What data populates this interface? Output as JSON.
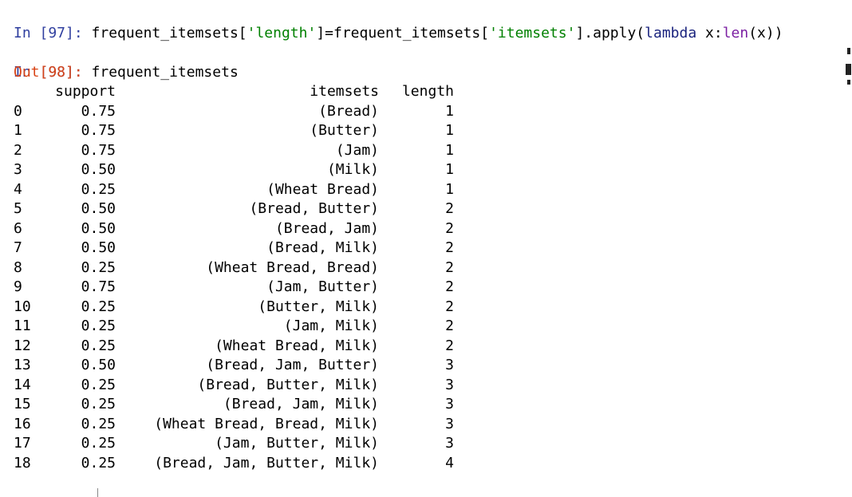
{
  "cells": [
    {
      "prompt": "In [97]:",
      "code": {
        "a": "frequent_itemsets[",
        "s1": "'length'",
        "b": "]=frequent_itemsets[",
        "s2": "'itemsets'",
        "c": "].apply(",
        "kw": "lambda",
        "d": " x:",
        "fn": "len",
        "e": "(x))"
      }
    },
    {
      "prompt": "In [98]:",
      "code_text": "frequent_itemsets",
      "out_prompt": "Out[98]:"
    }
  ],
  "dataframe": {
    "columns": [
      "",
      "support",
      "itemsets",
      "length"
    ],
    "rows": [
      [
        "0",
        "0.75",
        "(Bread)",
        "1"
      ],
      [
        "1",
        "0.75",
        "(Butter)",
        "1"
      ],
      [
        "2",
        "0.75",
        "(Jam)",
        "1"
      ],
      [
        "3",
        "0.50",
        "(Milk)",
        "1"
      ],
      [
        "4",
        "0.25",
        "(Wheat Bread)",
        "1"
      ],
      [
        "5",
        "0.50",
        "(Bread, Butter)",
        "2"
      ],
      [
        "6",
        "0.50",
        "(Bread, Jam)",
        "2"
      ],
      [
        "7",
        "0.50",
        "(Bread, Milk)",
        "2"
      ],
      [
        "8",
        "0.25",
        "(Wheat Bread, Bread)",
        "2"
      ],
      [
        "9",
        "0.75",
        "(Jam, Butter)",
        "2"
      ],
      [
        "10",
        "0.25",
        "(Butter, Milk)",
        "2"
      ],
      [
        "11",
        "0.25",
        "(Jam, Milk)",
        "2"
      ],
      [
        "12",
        "0.25",
        "(Wheat Bread, Milk)",
        "2"
      ],
      [
        "13",
        "0.50",
        "(Bread, Jam, Butter)",
        "3"
      ],
      [
        "14",
        "0.25",
        "(Bread, Butter, Milk)",
        "3"
      ],
      [
        "15",
        "0.25",
        "(Bread, Jam, Milk)",
        "3"
      ],
      [
        "16",
        "0.25",
        "(Wheat Bread, Bread, Milk)",
        "3"
      ],
      [
        "17",
        "0.25",
        "(Jam, Butter, Milk)",
        "3"
      ],
      [
        "18",
        "0.25",
        "(Bread, Jam, Butter, Milk)",
        "4"
      ]
    ]
  },
  "colors": {
    "in_prompt": "#303f9f",
    "out_prompt": "#d84315",
    "string": "#008000",
    "keyword": "#1a237e",
    "builtin": "#7b1fa2"
  }
}
